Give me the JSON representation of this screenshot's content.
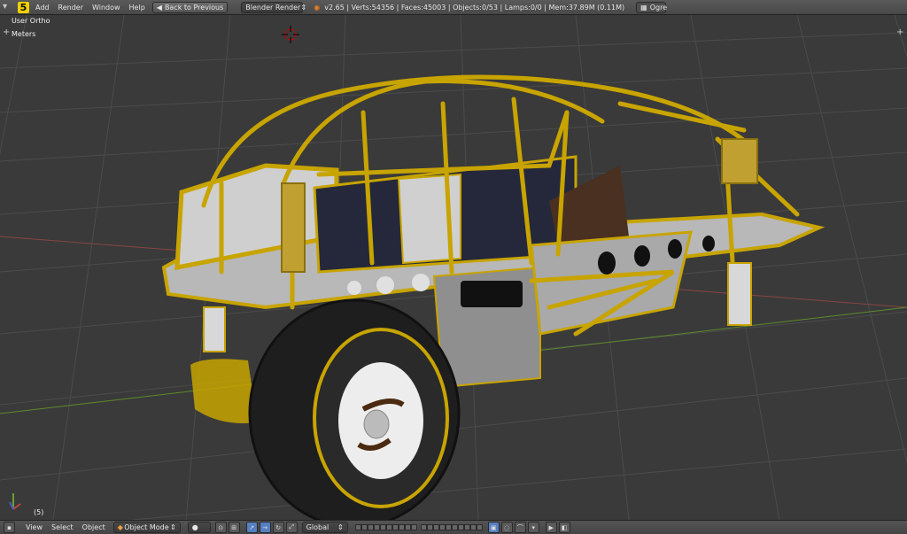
{
  "header": {
    "menus": [
      "Add",
      "Render",
      "Window",
      "Help"
    ],
    "back_button": "Back to Previous",
    "render_engine": "Blender Render",
    "stats": "v2.65 | Verts:54356 | Faces:45003 | Objects:0/53 | Lamps:0/0 | Mem:37.89M (0.11M)",
    "scene_name": "Ogre",
    "logo_text": "5"
  },
  "viewport": {
    "view_name": "User Ortho",
    "units": "Meters",
    "frame": "(5)"
  },
  "footer": {
    "menus": [
      "View",
      "Select",
      "Object"
    ],
    "mode": "Object Mode",
    "orientation": "Global"
  },
  "colors": {
    "roll_cage": "#c8a400",
    "grid": "#4a4a4a",
    "x_axis": "#a04040",
    "y_axis": "#6a9a2a",
    "tire": "#1e1e1e"
  }
}
